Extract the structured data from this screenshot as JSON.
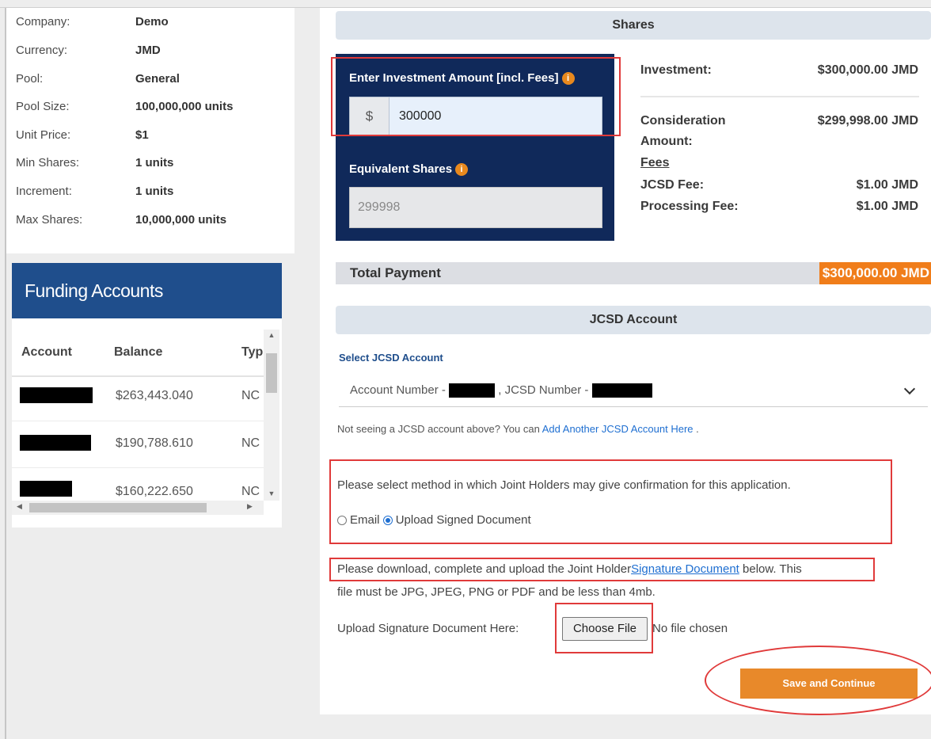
{
  "company_info": [
    {
      "label": "Company:",
      "value": "Demo"
    },
    {
      "label": "Currency:",
      "value": "JMD"
    },
    {
      "label": "Pool:",
      "value": "General"
    },
    {
      "label": "Pool Size:",
      "value": "100,000,000 units"
    },
    {
      "label": "Unit Price:",
      "value": "$1"
    },
    {
      "label": "Min Shares:",
      "value": "1 units"
    },
    {
      "label": "Increment:",
      "value": "1 units"
    },
    {
      "label": "Max Shares:",
      "value": "10,000,000 units"
    }
  ],
  "funding": {
    "title": "Funding Accounts",
    "columns": [
      "Account",
      "Balance",
      "Typ"
    ],
    "rows": [
      {
        "balance": "$263,443.040",
        "type": "NC"
      },
      {
        "balance": "$190,788.610",
        "type": "NC"
      },
      {
        "balance": "$160,222.650",
        "type": "NC"
      }
    ]
  },
  "shares": {
    "section_title": "Shares",
    "investment_label": "Enter Investment Amount [incl. Fees]",
    "currency_prefix": "$",
    "investment_value": "300000",
    "equivalent_label": "Equivalent Shares",
    "equivalent_value": "299998",
    "info_glyph": "i"
  },
  "summary": {
    "investment_label": "Investment:",
    "investment_value": "$300,000.00 JMD",
    "consideration_label_1": "Consideration",
    "consideration_label_2": "Amount:",
    "consideration_value": "$299,998.00 JMD",
    "fees_label": "Fees",
    "jcsd_fee_label": "JCSD Fee:",
    "jcsd_fee_value": "$1.00 JMD",
    "processing_fee_label": "Processing Fee:",
    "processing_fee_value": "$1.00 JMD"
  },
  "total": {
    "label": "Total Payment",
    "value": "$300,000.00 JMD"
  },
  "jcsd": {
    "section_title": "JCSD Account",
    "select_label": "Select JCSD Account",
    "account_number_prefix": "Account Number -",
    "jcsd_number_prefix": ", JCSD Number -",
    "hint_text": "Not seeing a JCSD account above? You can",
    "hint_link": "Add Another JCSD Account Here",
    "hint_end": "."
  },
  "confirmation": {
    "prompt": "Please select method in which Joint Holders may give confirmation for this application.",
    "option_email": "Email",
    "option_upload": "Upload Signed Document",
    "selected": "Upload Signed Document"
  },
  "upload": {
    "download_text_1": "Please download, complete and upload the Joint Holder",
    "download_link": "Signature Document",
    "download_text_2": "below.",
    "download_text_3": "This",
    "download_line2": "file must be JPG, JPEG, PNG or PDF and be less than 4mb.",
    "upload_label": "Upload Signature Document Here:",
    "choose_file_label": "Choose File",
    "no_file_text": "No file chosen"
  },
  "actions": {
    "save_label": "Save and Continue"
  },
  "colors": {
    "navy_panel": "#10295a",
    "funding_header": "#1f4e8c",
    "accent_orange": "#e8892a",
    "total_orange": "#f07d1a",
    "annotation_red": "#e03a3a",
    "link_blue": "#1f6fd1"
  }
}
